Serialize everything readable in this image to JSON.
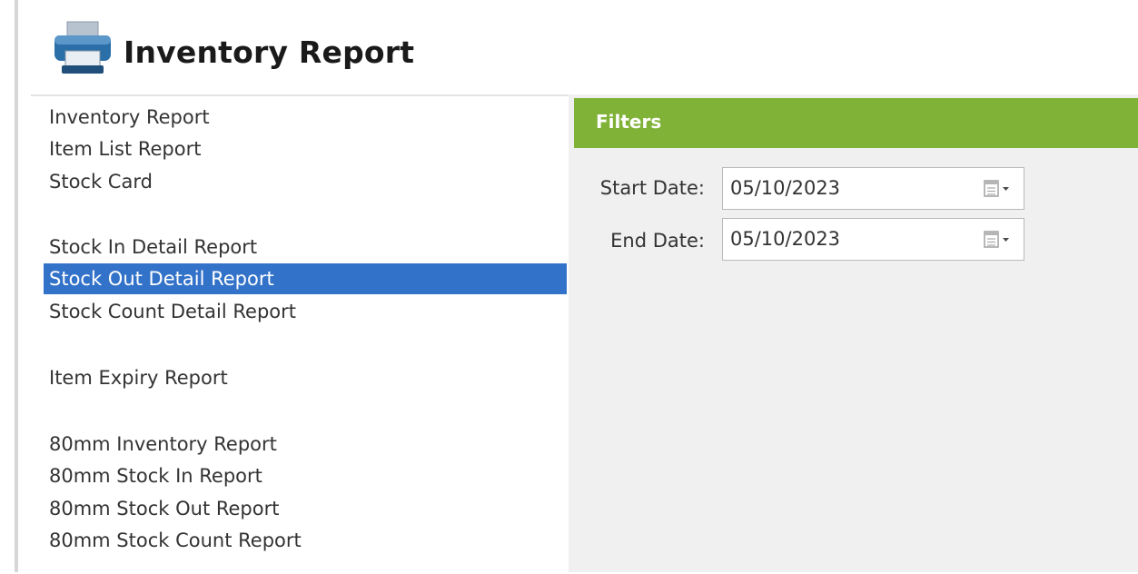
{
  "header": {
    "title": "Inventory Report",
    "icon": "printer-icon"
  },
  "report_list": {
    "selected_index": 4,
    "items": [
      {
        "label": "Inventory Report"
      },
      {
        "label": "Item List Report"
      },
      {
        "label": "Stock Card"
      },
      {
        "label": "Stock In Detail Report"
      },
      {
        "label": "Stock Out Detail Report"
      },
      {
        "label": "Stock Count Detail Report"
      },
      {
        "label": "Item Expiry Report"
      },
      {
        "label": "80mm Inventory Report"
      },
      {
        "label": "80mm Stock In Report"
      },
      {
        "label": "80mm Stock Out Report"
      },
      {
        "label": "80mm Stock Count Report"
      }
    ]
  },
  "filters": {
    "title": "Filters",
    "start_date": {
      "label": "Start Date:",
      "value": "05/10/2023",
      "icon": "calendar-dropdown-icon"
    },
    "end_date": {
      "label": "End Date:",
      "value": "05/10/2023",
      "icon": "calendar-dropdown-icon"
    }
  },
  "colors": {
    "filters_header": "#7fb236",
    "selection": "#3272c9",
    "panel_background": "#f0f0f0"
  }
}
